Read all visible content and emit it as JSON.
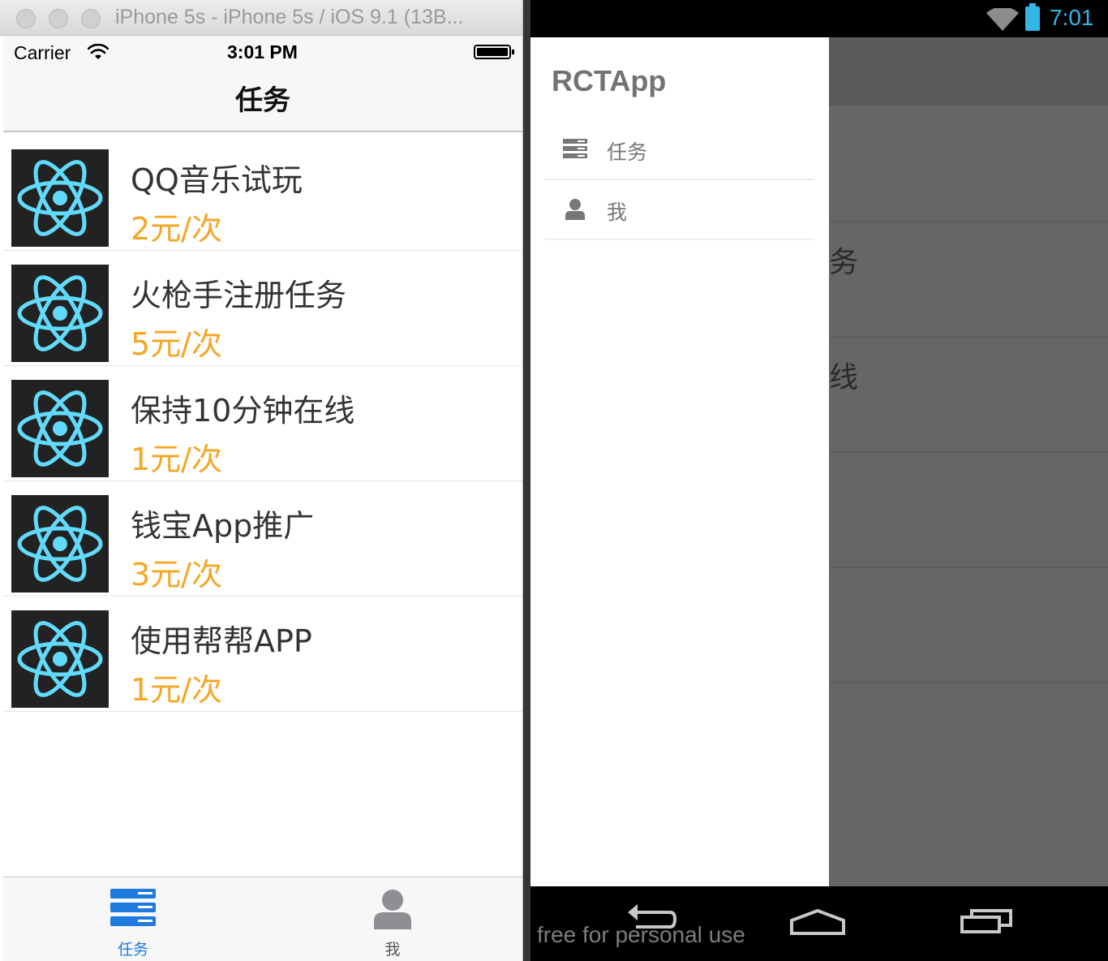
{
  "simulator": {
    "title": "iPhone 5s - iPhone 5s / iOS 9.1 (13B..."
  },
  "ios": {
    "status": {
      "carrier": "Carrier",
      "time": "3:01 PM"
    },
    "nav_title": "任务",
    "tasks": [
      {
        "title": "QQ音乐试玩",
        "price": "2元/次",
        "icon": "react-logo-icon"
      },
      {
        "title": "火枪手注册任务",
        "price": "5元/次",
        "icon": "react-logo-icon"
      },
      {
        "title": "保持10分钟在线",
        "price": "1元/次",
        "icon": "react-logo-icon"
      },
      {
        "title": "钱宝App推广",
        "price": "3元/次",
        "icon": "react-logo-icon"
      },
      {
        "title": "使用帮帮APP",
        "price": "1元/次",
        "icon": "react-logo-icon"
      }
    ],
    "tabs": [
      {
        "label": "任务",
        "icon": "list-icon",
        "active": true
      },
      {
        "label": "我",
        "icon": "person-icon",
        "active": false
      }
    ]
  },
  "android": {
    "status": {
      "time": "7:01"
    },
    "drawer": {
      "title": "RCTApp",
      "items": [
        {
          "label": "任务",
          "icon": "list-icon"
        },
        {
          "label": "我",
          "icon": "person-icon"
        }
      ]
    },
    "behind": {
      "row2_text": "务",
      "row3_text": "线"
    },
    "watermark": "free for personal use"
  },
  "colors": {
    "price": "#f5a623",
    "tab_active": "#1f7ae0",
    "tab_inactive": "#8e8e93",
    "react": "#61dafb",
    "android_status": "#33b5e5"
  }
}
